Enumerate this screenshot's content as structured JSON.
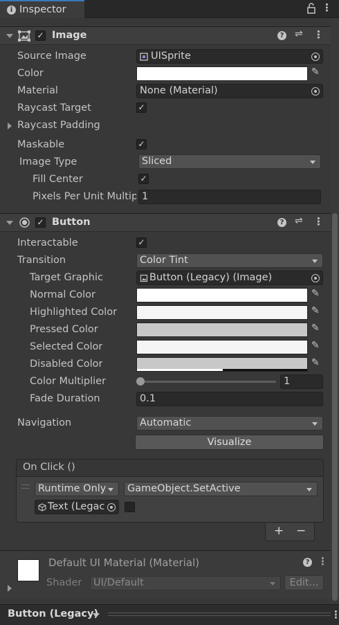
{
  "window": {
    "tab_title": "Inspector"
  },
  "image_component": {
    "title": "Image",
    "enabled": true,
    "rows": {
      "source_image": {
        "label": "Source Image",
        "value": "UISprite"
      },
      "color": {
        "label": "Color",
        "swatch": "#ffffff"
      },
      "material": {
        "label": "Material",
        "value": "None (Material)"
      },
      "raycast_target": {
        "label": "Raycast Target",
        "checked": true
      },
      "raycast_padding": {
        "label": "Raycast Padding"
      },
      "maskable": {
        "label": "Maskable",
        "checked": true
      },
      "image_type": {
        "label": "Image Type",
        "value": "Sliced"
      },
      "fill_center": {
        "label": "Fill Center",
        "checked": true
      },
      "pixels_per_unit": {
        "label": "Pixels Per Unit Multip",
        "value": "1"
      }
    }
  },
  "button_component": {
    "title": "Button",
    "enabled": true,
    "rows": {
      "interactable": {
        "label": "Interactable",
        "checked": true
      },
      "transition": {
        "label": "Transition",
        "value": "Color Tint"
      },
      "target_graphic": {
        "label": "Target Graphic",
        "value": "Button (Legacy) (Image)"
      },
      "normal_color": {
        "label": "Normal Color",
        "swatch": "#ffffff"
      },
      "highlighted_color": {
        "label": "Highlighted Color",
        "swatch": "#f5f5f5"
      },
      "pressed_color": {
        "label": "Pressed Color",
        "swatch": "#c8c8c8"
      },
      "selected_color": {
        "label": "Selected Color",
        "swatch": "#f5f5f5"
      },
      "disabled_color": {
        "label": "Disabled Color",
        "swatch": "#c8c8c8",
        "alpha": 0.5
      },
      "color_multiplier": {
        "label": "Color Multiplier",
        "value": "1",
        "slider_fraction": 0.0
      },
      "fade_duration": {
        "label": "Fade Duration",
        "value": "0.1"
      },
      "navigation": {
        "label": "Navigation",
        "value": "Automatic"
      },
      "visualize": {
        "label": "Visualize"
      }
    },
    "on_click": {
      "title": "On Click ()",
      "runtime": "Runtime Only",
      "function": "GameObject.SetActive",
      "object": "Text (Legac",
      "param_checked": false,
      "add_label": "+",
      "remove_label": "−"
    }
  },
  "material_section": {
    "title": "Default UI Material (Material)",
    "shader_label": "Shader",
    "shader_value": "UI/Default",
    "edit_label": "Edit..."
  },
  "bottom_bar": {
    "object_name": "Button (Legacy)"
  },
  "icons": {
    "tab": "info-icon",
    "lock": "lock-icon",
    "menu": "kebab-icon",
    "help": "help-icon",
    "presets": "presets-icon",
    "picker": "object-picker-icon",
    "eyedropper": "eyedropper-icon",
    "sprite": "sprite-icon",
    "cube": "cube-icon"
  },
  "colors": {
    "accent": "#3a79bb",
    "background": "#383838",
    "field": "#2a2a2a"
  }
}
